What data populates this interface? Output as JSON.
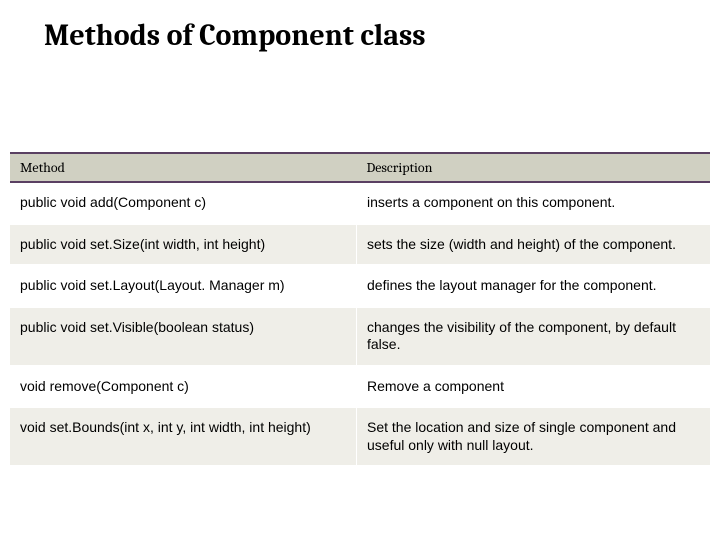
{
  "title": "Methods of Component class",
  "table": {
    "headers": {
      "col1": "Method",
      "col2": "Description"
    },
    "rows": [
      {
        "method": "public void add(Component c)",
        "desc": "inserts a component on this component."
      },
      {
        "method": "public void set.Size(int width, int height)",
        "desc": "sets the size (width and height) of the component."
      },
      {
        "method": "public void set.Layout(Layout. Manager m)",
        "desc": "defines the layout manager for the component."
      },
      {
        "method": "public void set.Visible(boolean status)",
        "desc": "changes the visibility of the component, by default false."
      },
      {
        "method": "void remove(Component c)",
        "desc": "Remove a component"
      },
      {
        "method": "void set.Bounds(int x, int y, int width, int height)",
        "desc": "Set the location and size of single component and useful only with null layout."
      }
    ]
  }
}
